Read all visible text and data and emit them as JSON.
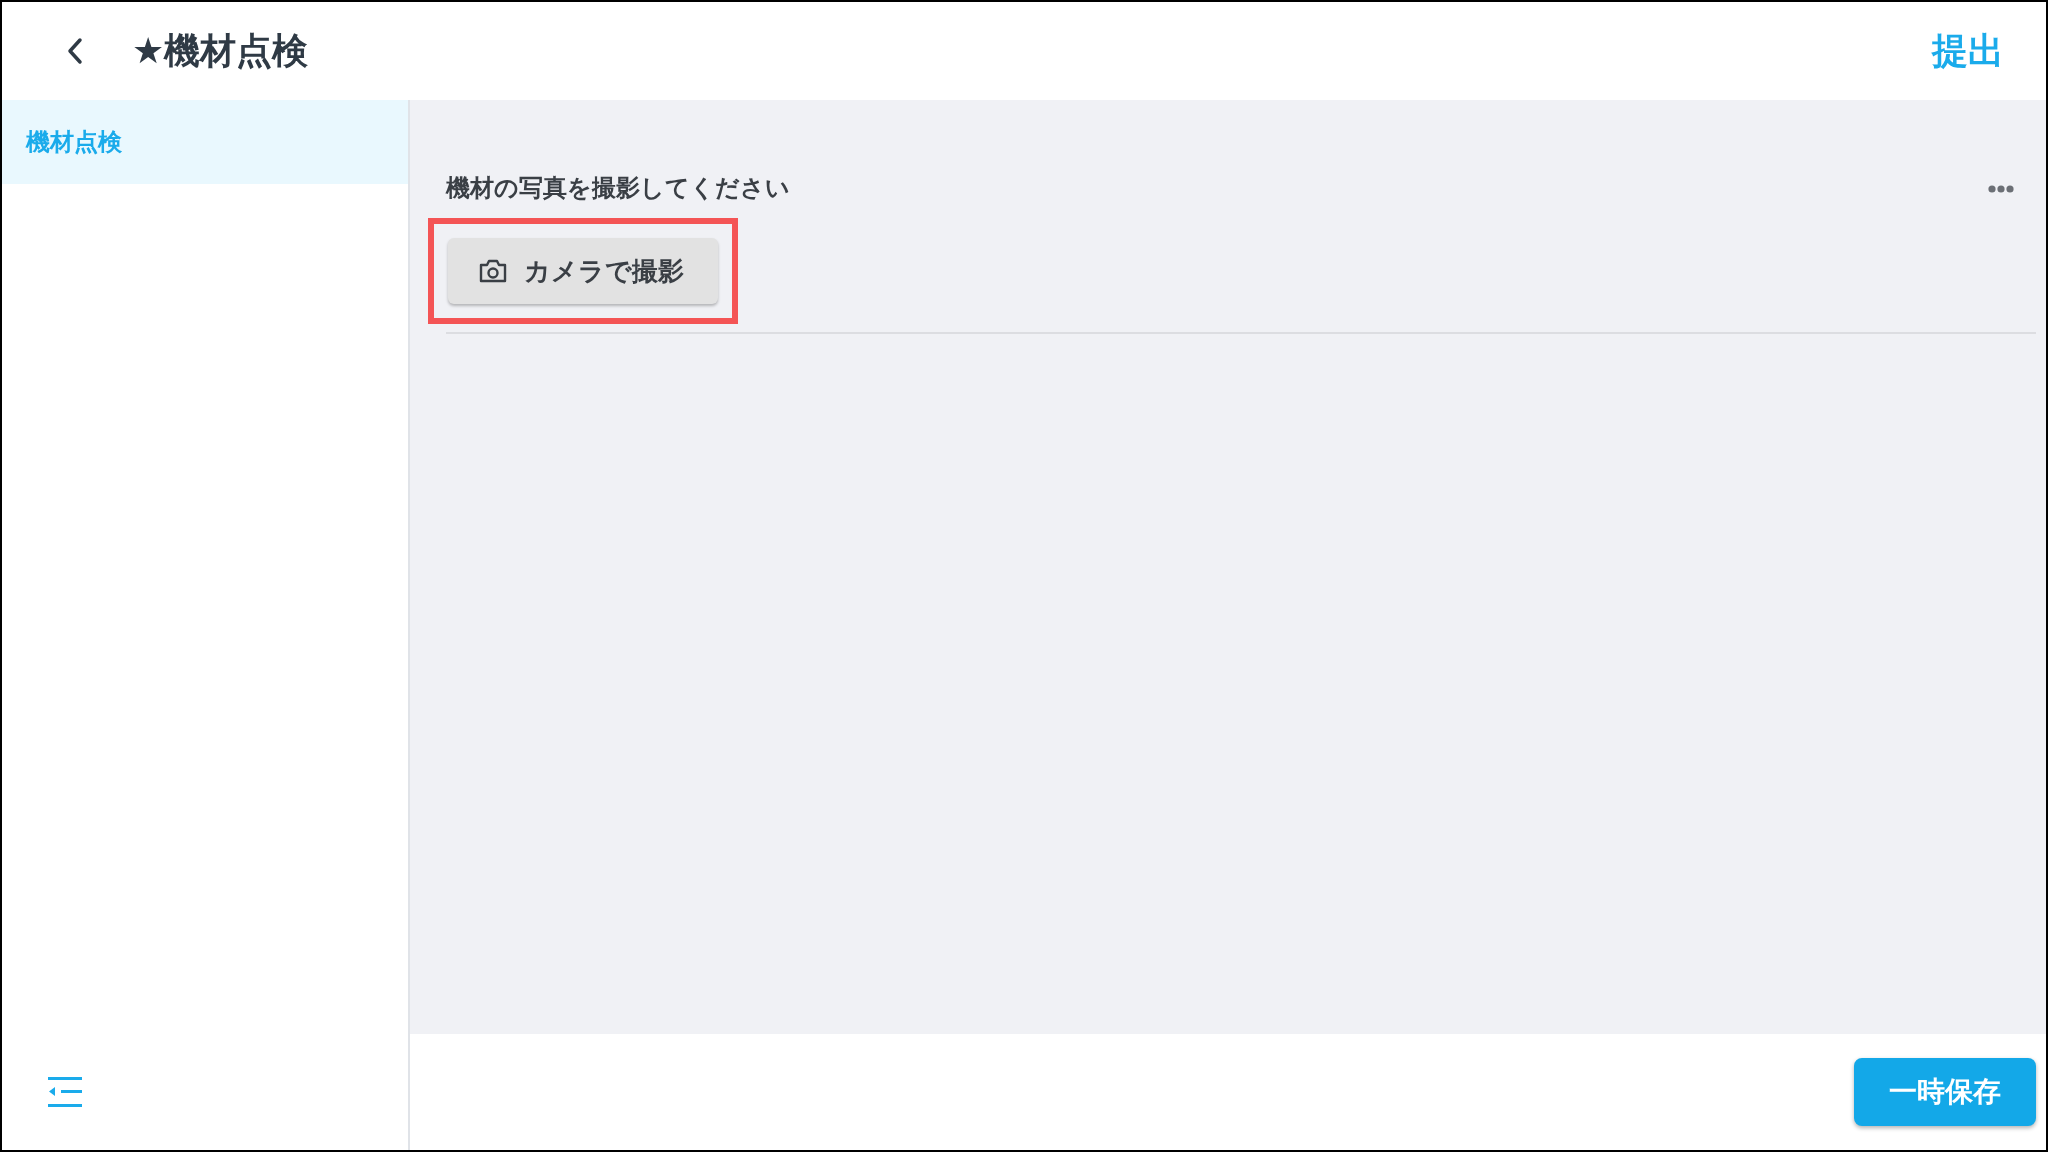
{
  "header": {
    "title": "★機材点検",
    "submit": "提出"
  },
  "sidebar": {
    "items": [
      {
        "label": "機材点検",
        "selected": true
      }
    ]
  },
  "question": {
    "label": "機材の写真を撮影してください",
    "button": {
      "label": "カメラで撮影",
      "highlighted": true
    }
  },
  "footer": {
    "save": "一時保存"
  }
}
